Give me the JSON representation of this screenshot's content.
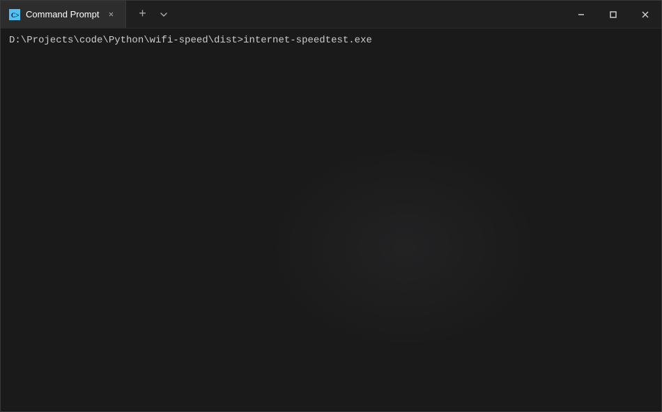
{
  "titlebar": {
    "tab_label": "Command Prompt",
    "tab_icon_text": "C>",
    "new_tab_symbol": "+",
    "dropdown_symbol": "⌄",
    "minimize_symbol": "─",
    "maximize_symbol": "□",
    "close_symbol": "✕"
  },
  "terminal": {
    "prompt_line": "D:\\Projects\\code\\Python\\wifi-speed\\dist>internet-speedtest.exe"
  }
}
